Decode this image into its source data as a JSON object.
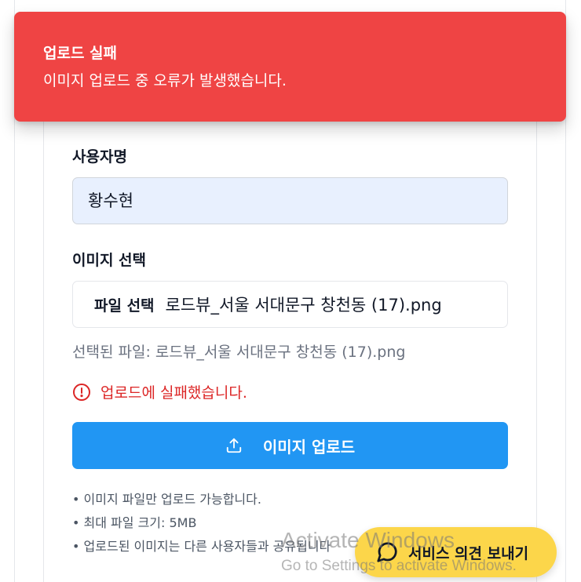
{
  "toast": {
    "title": "업로드 실패",
    "description": "이미지 업로드 중 오류가 발생했습니다."
  },
  "form": {
    "username_label": "사용자명",
    "username_value": "황수현",
    "image_label": "이미지 선택",
    "file_button_label": "파일 선택",
    "file_name": "로드뷰_서울 서대문구 창천동 (17).png",
    "selected_file_text": "선택된 파일: 로드뷰_서울 서대문구 창천동 (17).png",
    "error_message": "업로드에 실패했습니다.",
    "upload_button_label": "이미지 업로드"
  },
  "notes": [
    "이미지 파일만 업로드 가능합니다.",
    "최대 파일 크기: 5MB",
    "업로드된 이미지는 다른 사용자들과 공유됩니다"
  ],
  "feedback": {
    "label": "서비스 의견 보내기"
  },
  "watermark": {
    "title": "Activate Windows",
    "subtitle": "Go to Settings to activate Windows."
  },
  "colors": {
    "toast_bg": "#ef4444",
    "primary": "#2196f3",
    "error": "#dc2626",
    "feedback_bg": "#fcd64a"
  },
  "icons": [
    "alert-circle-icon",
    "upload-icon",
    "chat-bubble-icon"
  ]
}
